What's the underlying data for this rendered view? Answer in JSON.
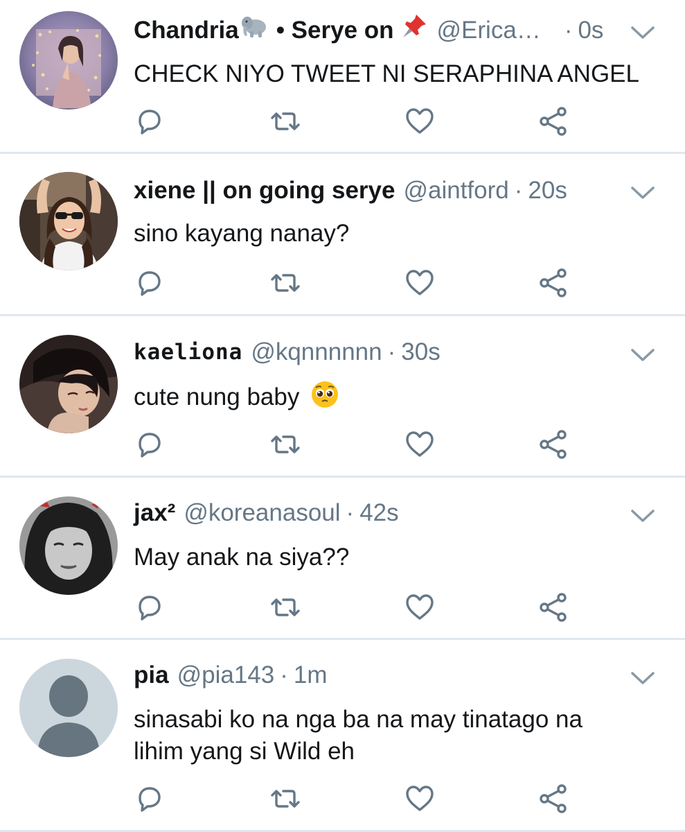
{
  "colors": {
    "text_primary": "#14171a",
    "text_secondary": "#657786",
    "icon_gray": "#657786",
    "divider": "#e1e8ed"
  },
  "tweets": [
    {
      "name": "Chandria",
      "name_suffix": "• Serye on",
      "name_emojis": [
        "elephant-emoji",
        "pushpin-emoji"
      ],
      "handle": "@Erica…",
      "time": "0s",
      "text": "CHECK NIYO TWEET NI SERAPHINA ANGEL"
    },
    {
      "name": "xiene || on going serye",
      "handle": "@aintford",
      "time": "20s",
      "text": "sino kayang nanay?"
    },
    {
      "name": "kaeliona",
      "handle": "@kqnnnnnn",
      "time": "30s",
      "text": "cute nung baby",
      "text_emoji": "pleading-face-emoji"
    },
    {
      "name": "jax²",
      "handle": "@koreanasoul",
      "time": "42s",
      "text": "May anak na siya??"
    },
    {
      "name": "pia",
      "handle": "@pia143",
      "time": "1m",
      "text": "sinasabi ko na nga ba na may tinatago na lihim yang si Wild eh"
    }
  ],
  "icons": {
    "reply": "reply-icon",
    "retweet": "retweet-icon",
    "like": "heart-icon",
    "share": "share-icon",
    "menu": "chevron-down-icon"
  },
  "separator": "·"
}
